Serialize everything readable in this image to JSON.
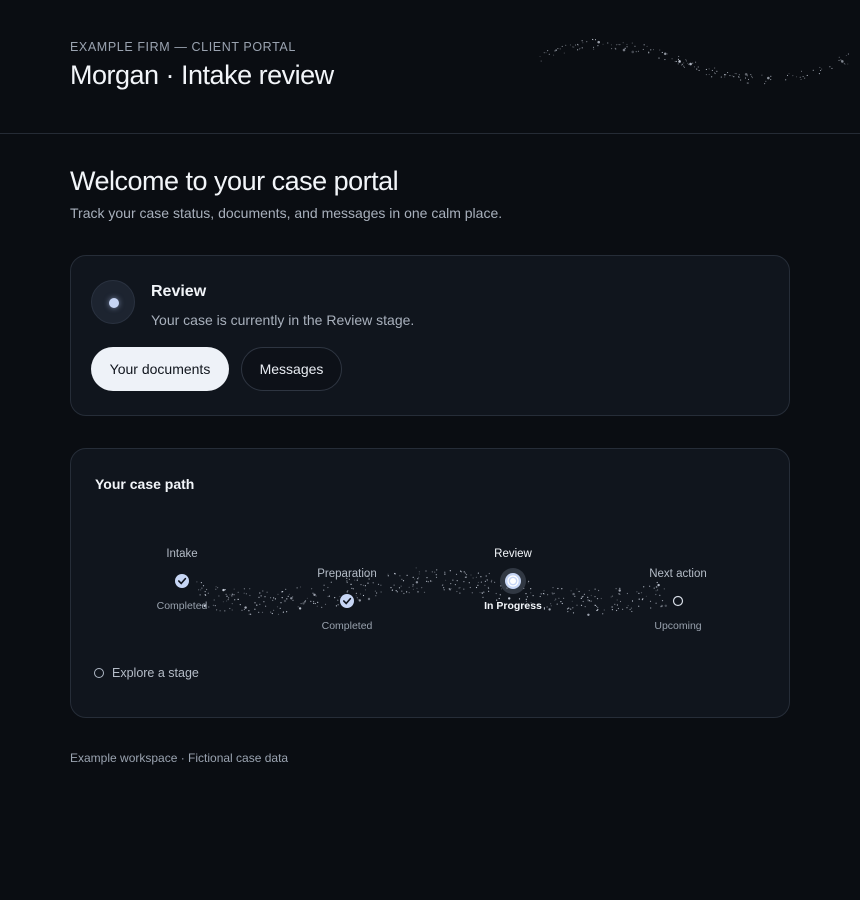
{
  "header": {
    "eyebrow": "EXAMPLE FIRM — CLIENT PORTAL",
    "title": "Morgan · Intake review"
  },
  "welcome": {
    "title": "Welcome to your case portal",
    "subtitle": "Track your case status, documents, and messages in one calm place."
  },
  "status": {
    "title": "Review",
    "description": "Your case is currently in the Review stage.",
    "primary_button": "Your documents",
    "secondary_button": "Messages"
  },
  "case_path": {
    "title": "Your case path",
    "stages": [
      {
        "label": "Intake",
        "status": "Completed",
        "state": "completed"
      },
      {
        "label": "Preparation",
        "status": "Completed",
        "state": "completed"
      },
      {
        "label": "Review",
        "status": "In Progress",
        "state": "active"
      },
      {
        "label": "Next action",
        "status": "Upcoming",
        "state": "upcoming"
      }
    ],
    "explore_label": "Explore a stage"
  },
  "footer": "Example workspace · Fictional case data",
  "colors": {
    "background": "#0a0d12",
    "card": "#10151d",
    "accent": "#c7d6f5"
  }
}
